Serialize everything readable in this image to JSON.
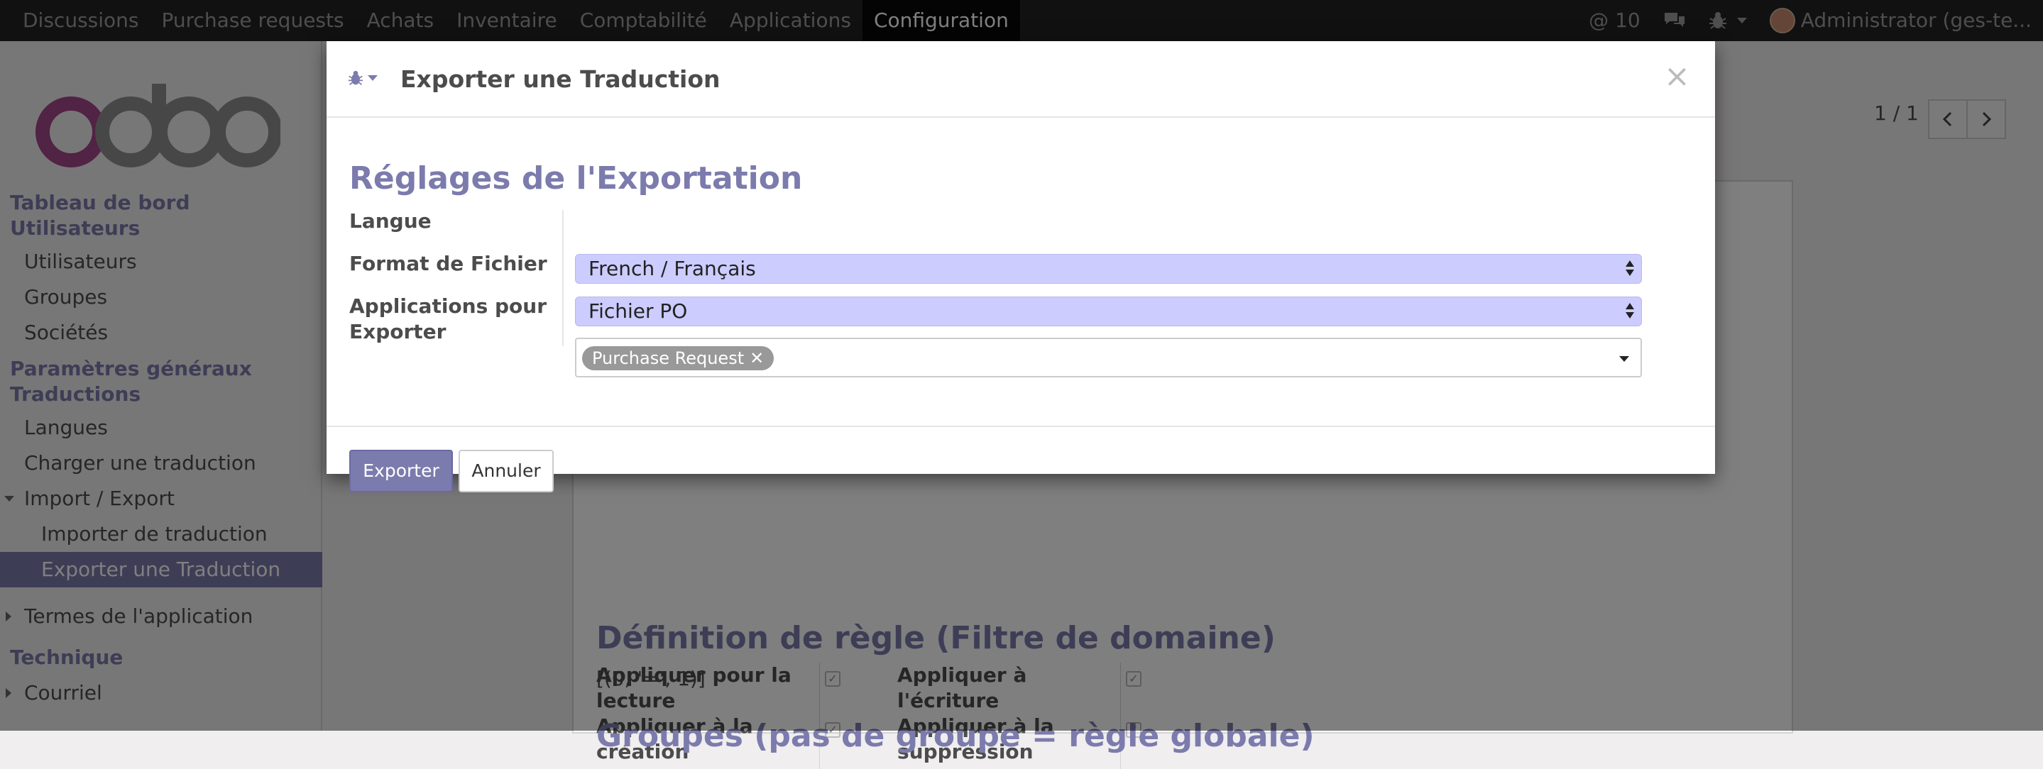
{
  "topbar": {
    "menu": [
      "Discussions",
      "Purchase requests",
      "Achats",
      "Inventaire",
      "Comptabilité",
      "Applications",
      "Configuration"
    ],
    "active": "Configuration",
    "mentions": "@ 10",
    "user": "Administrator (ges-te..."
  },
  "sidebar": {
    "dashboard": "Tableau de bord",
    "users_head": "Utilisateurs",
    "users": "Utilisateurs",
    "groups": "Groupes",
    "companies": "Sociétés",
    "general": "Paramètres généraux",
    "translations_head": "Traductions",
    "languages": "Langues",
    "load_translation": "Charger une traduction",
    "import_export": "Import / Export",
    "import_translation": "Importer de traduction",
    "export_translation": "Exporter une Traduction",
    "app_terms": "Termes de l'application",
    "technical": "Technique",
    "mail": "Courriel"
  },
  "pager": {
    "value": "1 / 1"
  },
  "background_form": {
    "read": "Appliquer pour la lecture",
    "write": "Appliquer à l'écriture",
    "create": "Appliquer à la création",
    "unlink": "Appliquer à la suppression",
    "rule_title": "Définition de règle (Filtre de domaine)",
    "domain": "[(0, '=', 1)]",
    "partial_title": "Groupes (pas de groupe = règle globale)"
  },
  "modal": {
    "title": "Exporter une Traduction",
    "close": "×",
    "section_title": "Réglages de l'Exportation",
    "lang_label": "Langue",
    "lang_value": "French / Français",
    "format_label": "Format de Fichier",
    "format_value": "Fichier PO",
    "apps_label": "Applications pour Exporter",
    "apps_tag": "Purchase Request",
    "export_button": "Exporter",
    "cancel_button": "Annuler"
  },
  "colors": {
    "accent": "#7c7bad",
    "select_bg": "#ccccff",
    "navbar": "#222222"
  }
}
